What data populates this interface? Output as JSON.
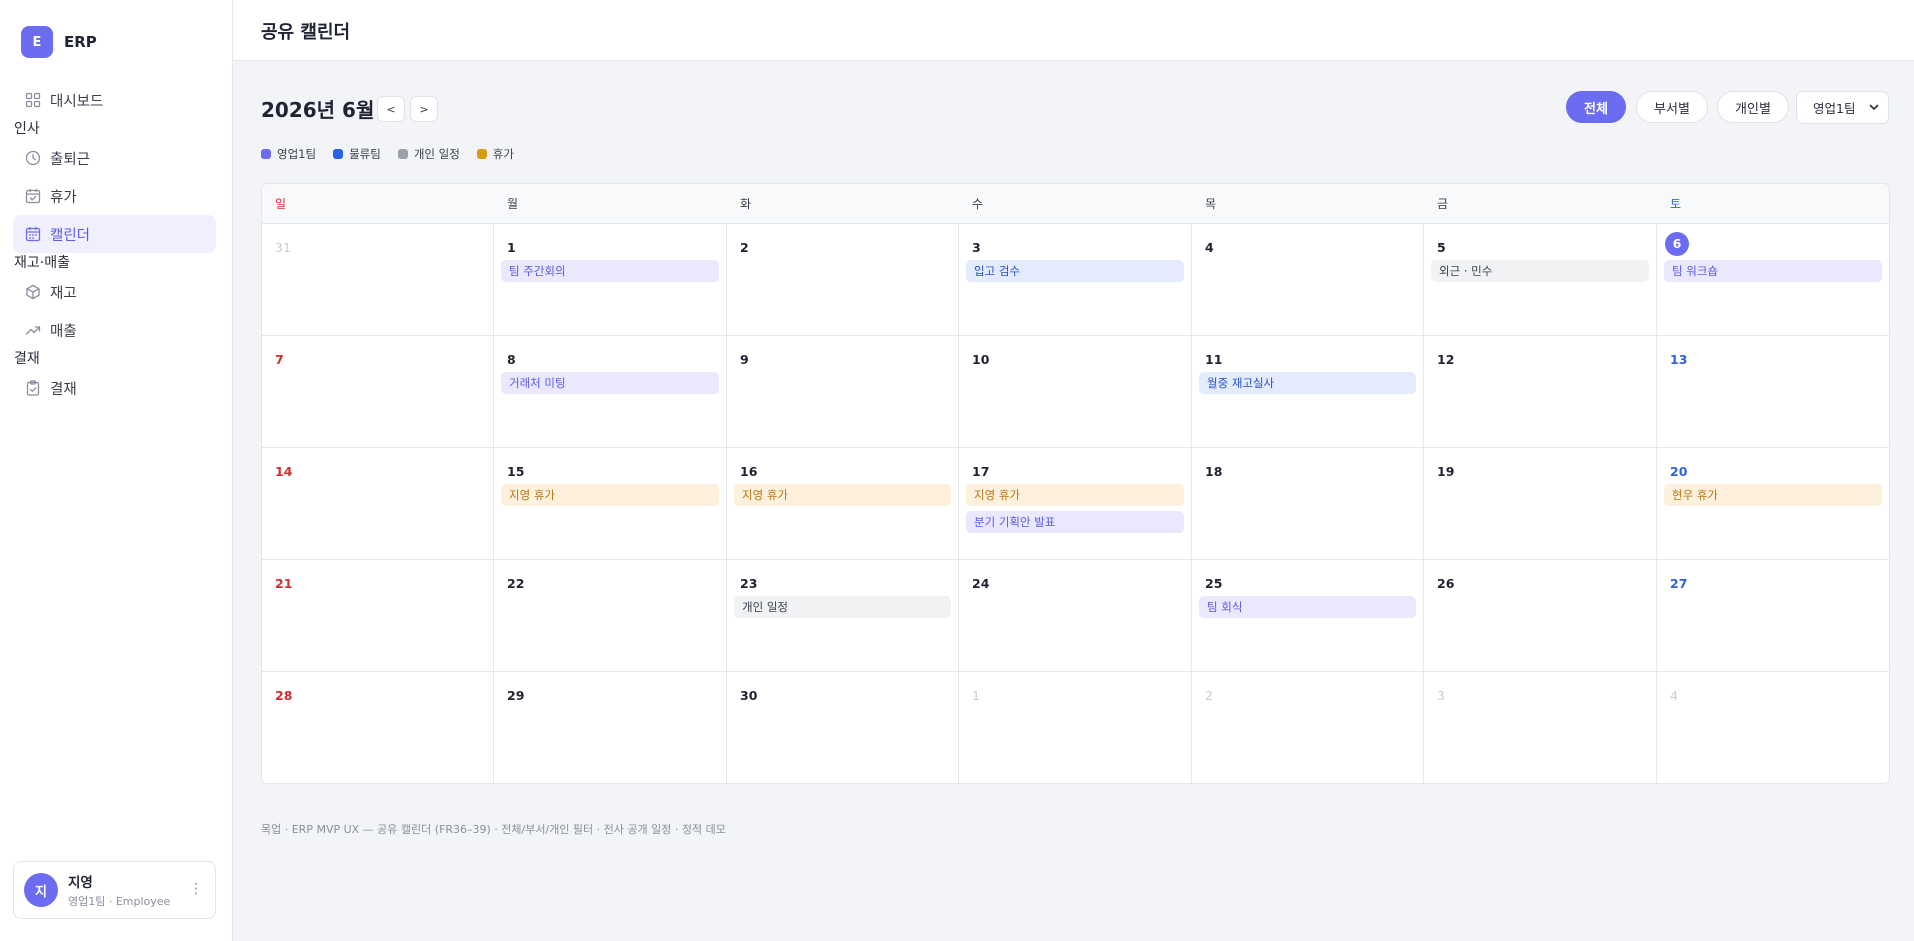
{
  "brand": {
    "logo": "E",
    "name": "ERP"
  },
  "nav": [
    {
      "type": "item",
      "label": "대시보드",
      "icon": "grid-icon",
      "name": "sidebar-item-dashboard",
      "active": false
    },
    {
      "type": "section",
      "label": "인사"
    },
    {
      "type": "item",
      "label": "출퇴근",
      "icon": "clock-icon",
      "name": "sidebar-item-attendance",
      "active": false
    },
    {
      "type": "item",
      "label": "휴가",
      "icon": "calendar-check-icon",
      "name": "sidebar-item-vacation",
      "active": false
    },
    {
      "type": "item",
      "label": "캘린더",
      "icon": "calendar-icon",
      "name": "sidebar-item-calendar",
      "active": true
    },
    {
      "type": "section",
      "label": "재고·매출"
    },
    {
      "type": "item",
      "label": "재고",
      "icon": "box-icon",
      "name": "sidebar-item-inventory",
      "active": false
    },
    {
      "type": "item",
      "label": "매출",
      "icon": "trend-up-icon",
      "name": "sidebar-item-sales",
      "active": false
    },
    {
      "type": "section",
      "label": "결재"
    },
    {
      "type": "item",
      "label": "결재",
      "icon": "clipboard-icon",
      "name": "sidebar-item-approval",
      "active": false
    }
  ],
  "user": {
    "avatar": "지",
    "name": "지영",
    "role": "영업1팀 · Employee",
    "more": "⋮"
  },
  "topbar": {
    "title": "공유 캘린더"
  },
  "calendar": {
    "month_title": "2026년 6월",
    "prev": "<",
    "next": ">",
    "filters": [
      {
        "label": "전체",
        "active": true
      },
      {
        "label": "부서별",
        "active": false
      },
      {
        "label": "개인별",
        "active": false
      }
    ],
    "team_select": "영업1팀",
    "legend": [
      {
        "label": "영업1팀",
        "color": "#6c6cf2"
      },
      {
        "label": "물류팀",
        "color": "#2563eb"
      },
      {
        "label": "개인 일정",
        "color": "#9ca0ab"
      },
      {
        "label": "휴가",
        "color": "#d99a14"
      }
    ],
    "weekdays": [
      "일",
      "월",
      "화",
      "수",
      "목",
      "금",
      "토"
    ],
    "weeks": [
      [
        {
          "day": "31",
          "dim": true,
          "events": []
        },
        {
          "day": "1",
          "events": [
            {
              "label": "팀 주간회의",
              "type": "sales"
            }
          ]
        },
        {
          "day": "2",
          "events": []
        },
        {
          "day": "3",
          "events": [
            {
              "label": "입고 검수",
              "type": "logistics"
            }
          ]
        },
        {
          "day": "4",
          "events": []
        },
        {
          "day": "5",
          "events": [
            {
              "label": "외근 · 민수",
              "type": "personal"
            }
          ]
        },
        {
          "day": "6",
          "today": true,
          "events": [
            {
              "label": "팀 워크숍",
              "type": "sales"
            }
          ]
        }
      ],
      [
        {
          "day": "7",
          "events": []
        },
        {
          "day": "8",
          "events": [
            {
              "label": "거래처 미팅",
              "type": "sales"
            }
          ]
        },
        {
          "day": "9",
          "events": []
        },
        {
          "day": "10",
          "events": []
        },
        {
          "day": "11",
          "events": [
            {
              "label": "월중 재고실사",
              "type": "logistics"
            }
          ]
        },
        {
          "day": "12",
          "events": []
        },
        {
          "day": "13",
          "events": []
        }
      ],
      [
        {
          "day": "14",
          "events": []
        },
        {
          "day": "15",
          "events": [
            {
              "label": "지영 휴가",
              "type": "vacation"
            }
          ]
        },
        {
          "day": "16",
          "events": [
            {
              "label": "지영 휴가",
              "type": "vacation"
            }
          ]
        },
        {
          "day": "17",
          "events": [
            {
              "label": "지영 휴가",
              "type": "vacation"
            },
            {
              "label": "분기 기획안 발표",
              "type": "sales"
            }
          ]
        },
        {
          "day": "18",
          "events": []
        },
        {
          "day": "19",
          "events": []
        },
        {
          "day": "20",
          "events": [
            {
              "label": "현우 휴가",
              "type": "vacation"
            }
          ]
        }
      ],
      [
        {
          "day": "21",
          "events": []
        },
        {
          "day": "22",
          "events": []
        },
        {
          "day": "23",
          "events": [
            {
              "label": "개인 일정",
              "type": "personal"
            }
          ]
        },
        {
          "day": "24",
          "events": []
        },
        {
          "day": "25",
          "events": [
            {
              "label": "팀 회식",
              "type": "sales"
            }
          ]
        },
        {
          "day": "26",
          "events": []
        },
        {
          "day": "27",
          "events": []
        }
      ],
      [
        {
          "day": "28",
          "events": []
        },
        {
          "day": "29",
          "events": []
        },
        {
          "day": "30",
          "events": []
        },
        {
          "day": "1",
          "dim": true,
          "events": []
        },
        {
          "day": "2",
          "dim": true,
          "events": []
        },
        {
          "day": "3",
          "dim": true,
          "events": []
        },
        {
          "day": "4",
          "dim": true,
          "events": []
        }
      ]
    ]
  },
  "footnote": "목업 · ERP MVP UX — 공유 캘린더 (FR36–39) · 전체/부서/개인 필터 · 전사 공개 일정 · 정적 데모"
}
